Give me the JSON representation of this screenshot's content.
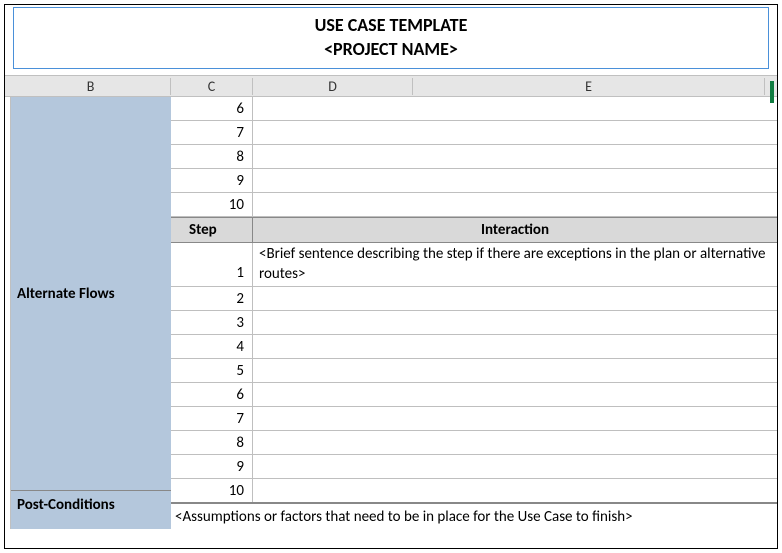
{
  "title": {
    "line1": "USE CASE TEMPLATE",
    "line2": "<PROJECT NAME>"
  },
  "columns": {
    "b": "B",
    "c": "C",
    "d": "D",
    "e": "E"
  },
  "upper_steps": [
    "6",
    "7",
    "8",
    "9",
    "10"
  ],
  "section_header": {
    "step": "Step",
    "interaction": "Interaction"
  },
  "side_labels": {
    "alternate_flows": "Alternate Flows",
    "post_conditions": "Post-Conditions"
  },
  "alt_rows": [
    {
      "num": "1",
      "text": "<Brief sentence describing the step if there are exceptions in the plan or alternative routes>"
    },
    {
      "num": "2",
      "text": ""
    },
    {
      "num": "3",
      "text": ""
    },
    {
      "num": "4",
      "text": ""
    },
    {
      "num": "5",
      "text": ""
    },
    {
      "num": "6",
      "text": ""
    },
    {
      "num": "7",
      "text": ""
    },
    {
      "num": "8",
      "text": ""
    },
    {
      "num": "9",
      "text": ""
    },
    {
      "num": "10",
      "text": ""
    }
  ],
  "post_conditions_text": "<Assumptions or factors that need to be in place for the Use Case to finish>"
}
